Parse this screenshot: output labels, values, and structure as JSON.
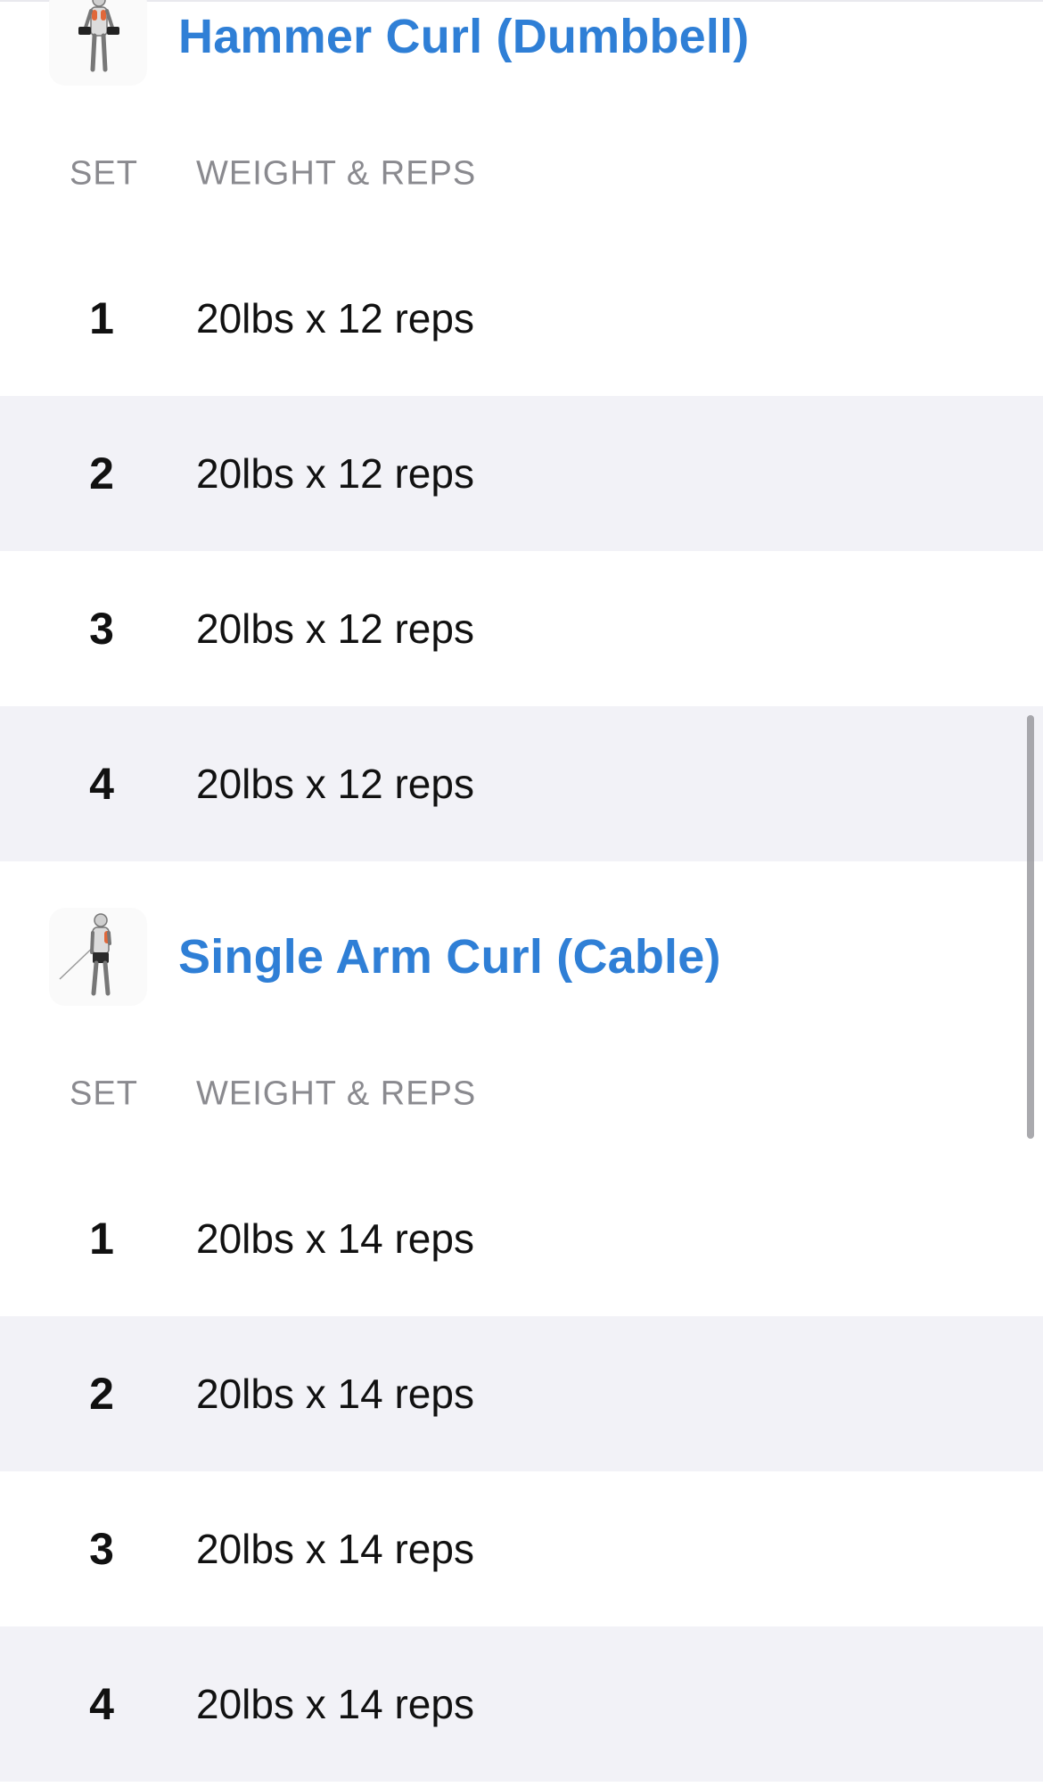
{
  "exercises": [
    {
      "title": "Hammer Curl (Dumbbell)",
      "icon": "dumbbell-hammer-curl-figure-icon",
      "headers": {
        "set": "SET",
        "weight": "WEIGHT & REPS"
      },
      "sets": [
        {
          "number": "1",
          "value": "20lbs x 12 reps"
        },
        {
          "number": "2",
          "value": "20lbs x 12 reps"
        },
        {
          "number": "3",
          "value": "20lbs x 12 reps"
        },
        {
          "number": "4",
          "value": "20lbs x 12 reps"
        }
      ]
    },
    {
      "title": "Single Arm Curl (Cable)",
      "icon": "cable-single-arm-curl-figure-icon",
      "headers": {
        "set": "SET",
        "weight": "WEIGHT & REPS"
      },
      "sets": [
        {
          "number": "1",
          "value": "20lbs x 14 reps"
        },
        {
          "number": "2",
          "value": "20lbs x 14 reps"
        },
        {
          "number": "3",
          "value": "20lbs x 14 reps"
        },
        {
          "number": "4",
          "value": "20lbs x 14 reps"
        }
      ]
    }
  ],
  "colors": {
    "accent": "#2f7fd6",
    "row_shade": "#f2f2f7",
    "header_text": "#8a8a8f",
    "muscle_highlight": "#e0683a"
  }
}
